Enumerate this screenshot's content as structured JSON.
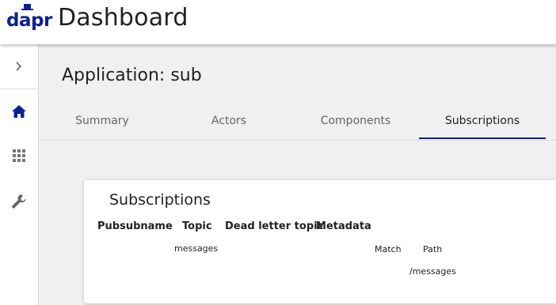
{
  "header": {
    "logo_text": "dapr",
    "title": "Dashboard"
  },
  "sidebar": {
    "items": [
      {
        "icon": "chevron-right-icon"
      },
      {
        "icon": "home-icon",
        "active_color": "#0d2192"
      },
      {
        "icon": "grid-icon"
      },
      {
        "icon": "wrench-icon"
      }
    ]
  },
  "main": {
    "heading": "Application: sub",
    "tabs": [
      {
        "label": "Summary"
      },
      {
        "label": "Actors"
      },
      {
        "label": "Components"
      },
      {
        "label": "Subscriptions",
        "active": true
      }
    ]
  },
  "card": {
    "title": "Subscriptions",
    "columns": [
      "Pubsubname",
      "Topic",
      "Dead letter topic",
      "Metadata"
    ],
    "rows": [
      {
        "pubsubname": "",
        "topic": "messages",
        "dead_letter_topic": "",
        "metadata": "",
        "rules_headers": [
          "Match",
          "Path"
        ],
        "rules": [
          {
            "match": "",
            "path": "/messages"
          }
        ]
      }
    ]
  },
  "colors": {
    "brand": "#0d2192",
    "tab_indicator": "#1a237e"
  }
}
